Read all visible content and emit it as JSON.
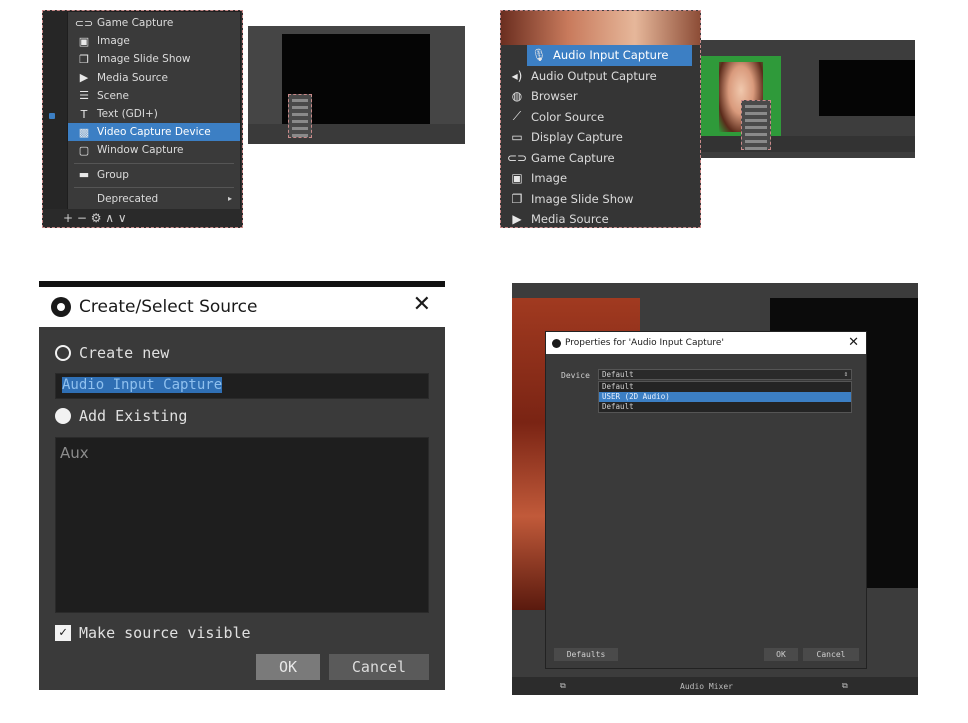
{
  "panel1": {
    "menu": [
      {
        "label": "Game Capture",
        "icon": "gamepad-icon"
      },
      {
        "label": "Image",
        "icon": "image-icon"
      },
      {
        "label": "Image Slide Show",
        "icon": "slideshow-icon"
      },
      {
        "label": "Media Source",
        "icon": "play-icon"
      },
      {
        "label": "Scene",
        "icon": "list-icon"
      },
      {
        "label": "Text (GDI+)",
        "icon": "text-icon"
      },
      {
        "label": "Video Capture Device",
        "icon": "camera-icon",
        "selected": true
      },
      {
        "label": "Window Capture",
        "icon": "window-icon"
      },
      {
        "label": "Group",
        "icon": "folder-icon"
      },
      {
        "label": "Deprecated",
        "icon": "",
        "submenu": true
      }
    ],
    "toolbar_glyphs": "+  −  ⚙  ∧  ∨"
  },
  "panel2": {
    "menu": [
      {
        "label": "Audio Input Capture",
        "icon": "microphone-icon",
        "selected": true
      },
      {
        "label": "Audio Output Capture",
        "icon": "speaker-icon"
      },
      {
        "label": "Browser",
        "icon": "globe-icon"
      },
      {
        "label": "Color Source",
        "icon": "brush-icon"
      },
      {
        "label": "Display Capture",
        "icon": "monitor-icon"
      },
      {
        "label": "Game Capture",
        "icon": "gamepad-icon"
      },
      {
        "label": "Image",
        "icon": "image-icon"
      },
      {
        "label": "Image Slide Show",
        "icon": "slideshow-icon"
      },
      {
        "label": "Media Source",
        "icon": "play-icon"
      }
    ]
  },
  "panel3": {
    "title": "Create/Select Source",
    "create_new_label": "Create new",
    "name_value": "Audio Input Capture",
    "add_existing_label": "Add Existing",
    "existing_items": [
      "Aux"
    ],
    "make_visible_label": "Make source visible",
    "make_visible_checked": true,
    "ok_label": "OK",
    "cancel_label": "Cancel"
  },
  "panel4": {
    "title": "Properties for 'Audio Input Capture'",
    "device_label": "Device",
    "device_value": "Default",
    "device_options": [
      {
        "label": "Default",
        "selected": false
      },
      {
        "label": "USER (2D Audio)",
        "selected": true
      },
      {
        "label": "Default",
        "selected": false
      }
    ],
    "defaults_label": "Defaults",
    "ok_label": "OK",
    "cancel_label": "Cancel",
    "footer_label": "Audio Mixer"
  },
  "colors": {
    "selection": "#3c7fc4",
    "menu_bg": "#3a3a3a",
    "dialog_bg": "#3a3a3a"
  }
}
